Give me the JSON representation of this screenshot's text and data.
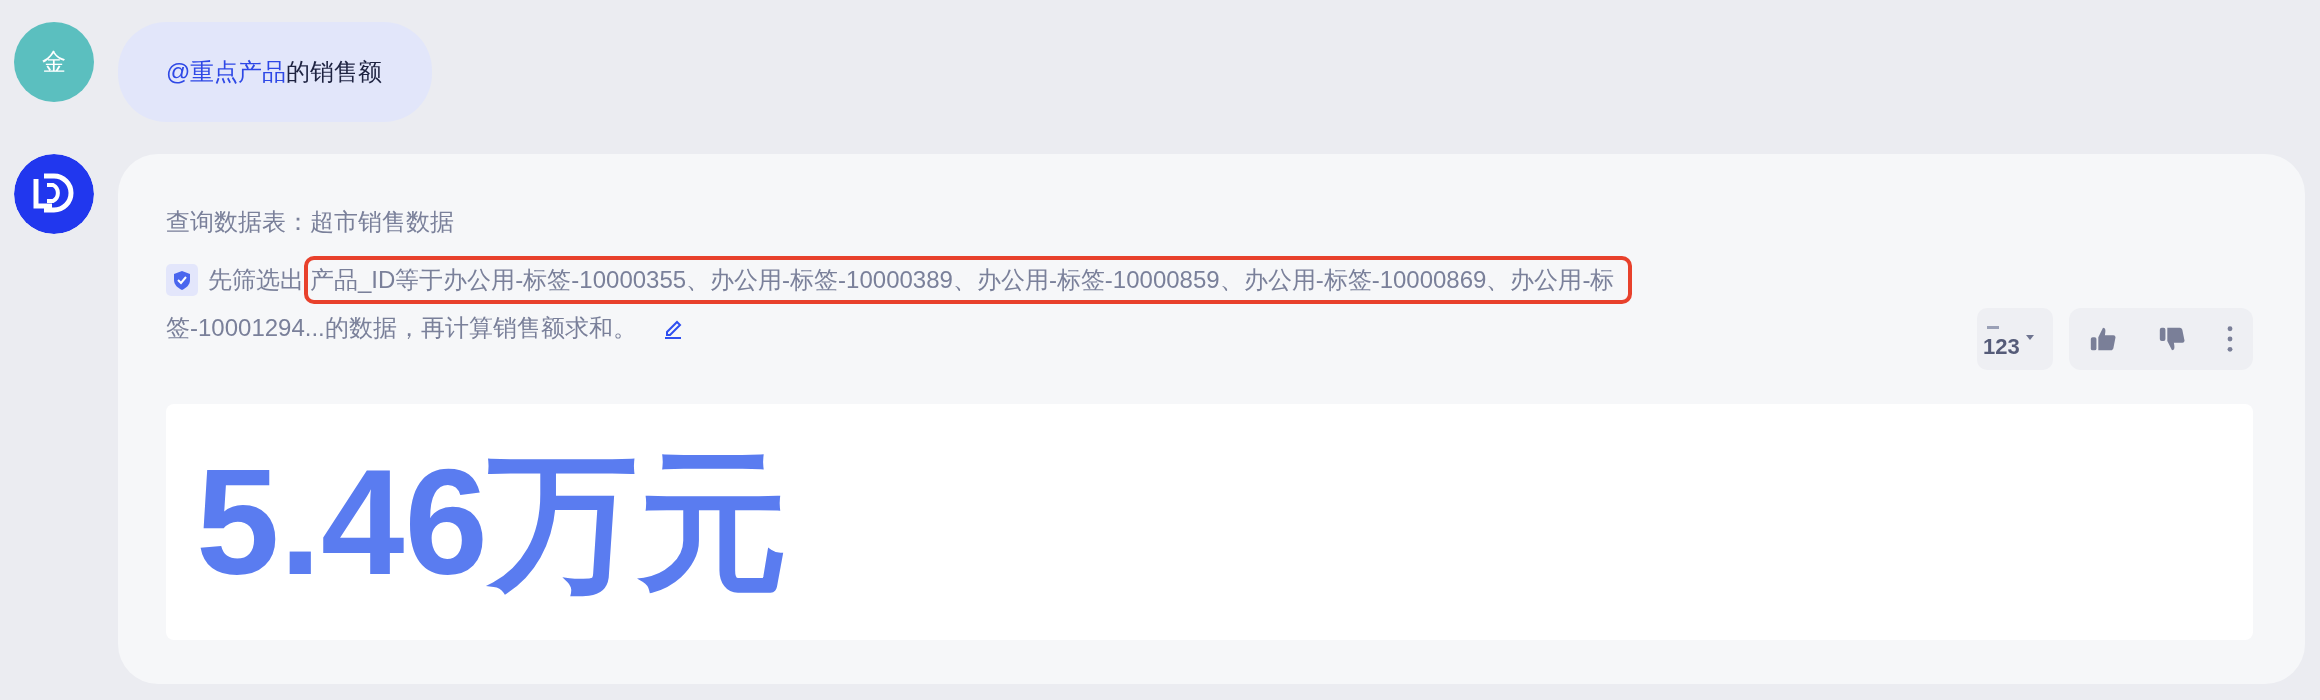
{
  "user_message": {
    "avatar": "金",
    "mention": "@重点产品",
    "text": "的销售额"
  },
  "answer": {
    "source": "查询数据表：超市销售数据",
    "filter_prefix": "先筛选出",
    "filter_highlighted": "产品_ID等于办公用-标签-10000355、办公用-标签-10000389、办公用-标签-10000859、办公用-标签-10000869、办公用-标",
    "filter_rest": "签-10001294...的数据，再计算销售额求和。",
    "format_button": {
      "label": "123"
    },
    "result": "5.46万元"
  }
}
